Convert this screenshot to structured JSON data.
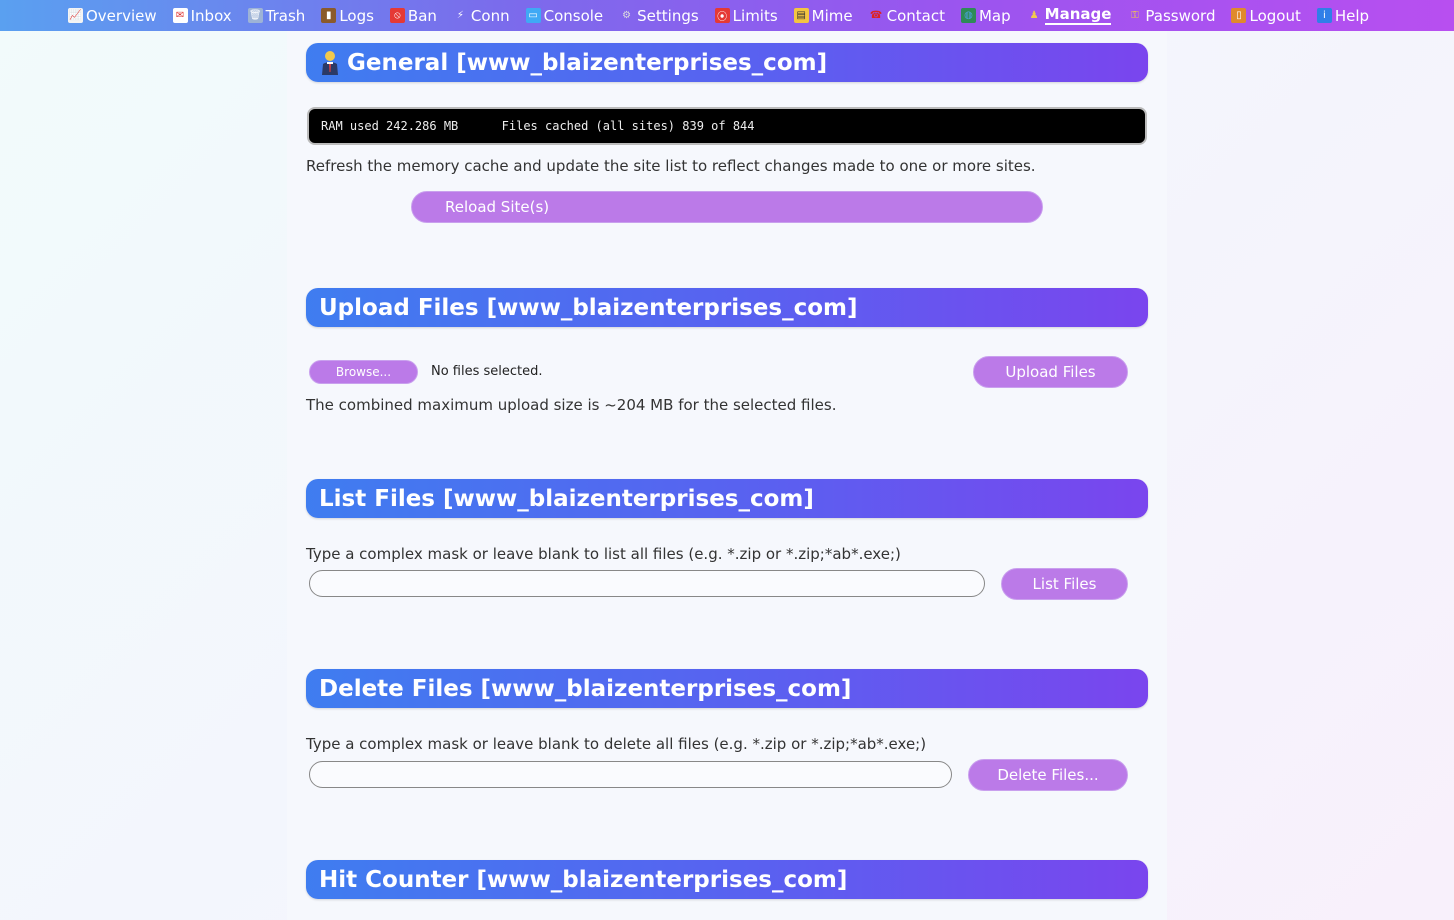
{
  "nav": {
    "items": [
      {
        "label": "Overview",
        "icon": "chart-icon"
      },
      {
        "label": "Inbox",
        "icon": "envelope-icon"
      },
      {
        "label": "Trash",
        "icon": "trash-icon"
      },
      {
        "label": "Logs",
        "icon": "log-icon"
      },
      {
        "label": "Ban",
        "icon": "ban-icon"
      },
      {
        "label": "Conn",
        "icon": "plug-icon"
      },
      {
        "label": "Console",
        "icon": "monitor-icon"
      },
      {
        "label": "Settings",
        "icon": "gear-icon"
      },
      {
        "label": "Limits",
        "icon": "limit-icon"
      },
      {
        "label": "Mime",
        "icon": "mime-icon"
      },
      {
        "label": "Contact",
        "icon": "phone-icon"
      },
      {
        "label": "Map",
        "icon": "globe-icon"
      },
      {
        "label": "Manage",
        "icon": "person-icon"
      },
      {
        "label": "Password",
        "icon": "key-icon"
      },
      {
        "label": "Logout",
        "icon": "door-icon"
      },
      {
        "label": "Help",
        "icon": "info-icon"
      }
    ],
    "active": "Manage"
  },
  "general": {
    "title": "General [www_blaizenterprises_com]",
    "ram": "RAM used 242.286 MB",
    "cache": "Files cached (all sites) 839 of 844",
    "desc": "Refresh the memory cache and update the site list to reflect changes made to one or more sites.",
    "reload_label": "Reload Site(s)"
  },
  "upload": {
    "title": "Upload Files [www_blaizenterprises_com]",
    "browse_label": "Browse...",
    "no_files": "No files selected.",
    "upload_label": "Upload Files",
    "desc": "The combined maximum upload size is ~204 MB for the selected files."
  },
  "list": {
    "title": "List Files [www_blaizenterprises_com]",
    "desc": "Type a complex mask or leave blank to list all files (e.g. *.zip or *.zip;*ab*.exe;)",
    "mask_value": "",
    "button_label": "List Files"
  },
  "delete": {
    "title": "Delete Files [www_blaizenterprises_com]",
    "desc": "Type a complex mask or leave blank to delete all files (e.g. *.zip or *.zip;*ab*.exe;)",
    "mask_value": "",
    "button_label": "Delete Files..."
  },
  "hits": {
    "title": "Hit Counter [www_blaizenterprises_com]"
  },
  "colors": {
    "accent_button": "#bb7ae8",
    "header_start": "#3f7df0",
    "header_end": "#7a45ee"
  }
}
